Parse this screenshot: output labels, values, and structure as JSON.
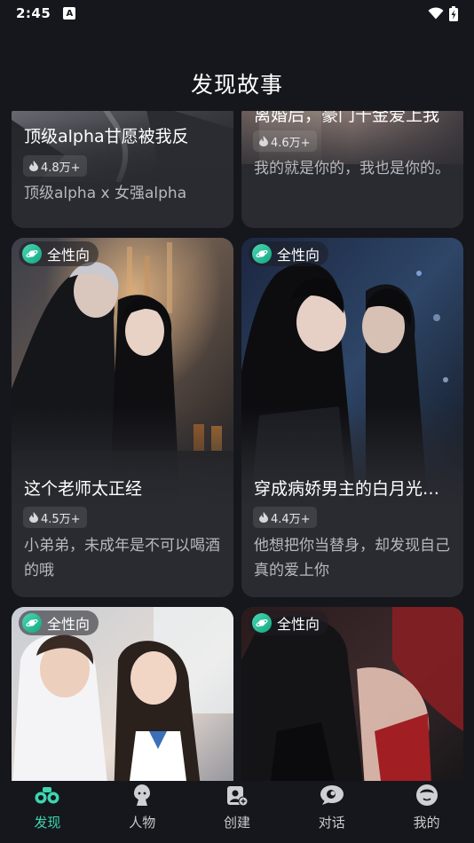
{
  "status_bar": {
    "time": "2:45",
    "notification_letter": "A"
  },
  "header": {
    "title": "发现故事"
  },
  "accent_color": "#3dd6b0",
  "stories": [
    {
      "title": "顶级alpha甘愿被我反",
      "hotness": "4.8万+",
      "description": "顶级alpha x 女强alpha"
    },
    {
      "title": "离婚后，豪门千金爱上我",
      "hotness": "4.6万+",
      "description": "我的就是你的，我也是你的。"
    },
    {
      "tag": "全性向",
      "title": "这个老师太正经",
      "hotness": "4.5万+",
      "description": "小弟弟，未成年是不可以喝酒的哦"
    },
    {
      "tag": "全性向",
      "title": "穿成病娇男主的白月光…",
      "hotness": "4.4万+",
      "description": "他想把你当替身，却发现自己真的爱上你"
    },
    {
      "tag": "全性向"
    },
    {
      "tag": "全性向"
    }
  ],
  "bottom_nav": [
    {
      "label": "发现",
      "icon": "binoculars-icon",
      "active": true
    },
    {
      "label": "人物",
      "icon": "character-icon",
      "active": false
    },
    {
      "label": "创建",
      "icon": "create-icon",
      "active": false
    },
    {
      "label": "对话",
      "icon": "chat-icon",
      "active": false
    },
    {
      "label": "我的",
      "icon": "profile-icon",
      "active": false
    }
  ]
}
